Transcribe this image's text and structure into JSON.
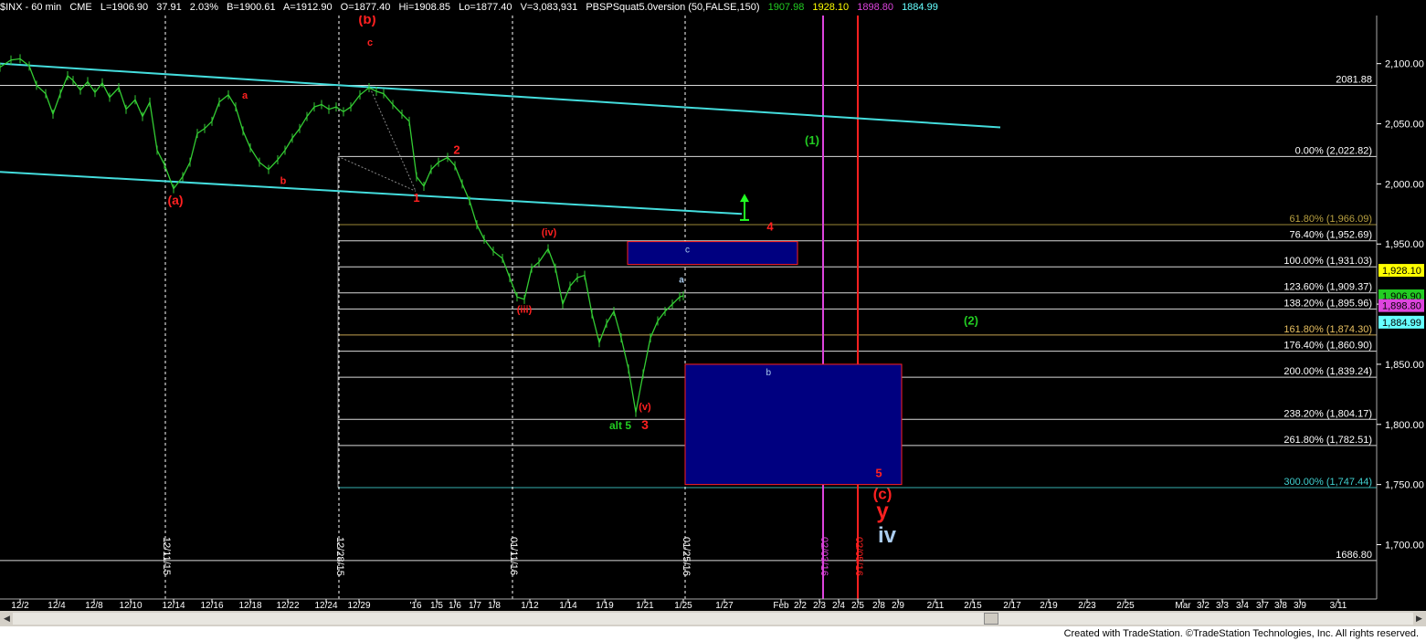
{
  "header": {
    "symbol": "$INX - 60 min",
    "exchange": "CME",
    "last": "L=1906.90",
    "change": "37.91",
    "change_pct": "2.03%",
    "bid": "B=1900.61",
    "ask": "A=1912.90",
    "open": "O=1877.40",
    "high": "Hi=1908.85",
    "low": "Lo=1877.40",
    "volume": "V=3,083,931",
    "indicator": "PBSPSquat5.0version (50,FALSE,150)",
    "ind_val1": "1907.98",
    "ind_val2": "1928.10",
    "ind_val3": "1898.80",
    "ind_val4": "1884.99"
  },
  "footer": {
    "credit": "Created with TradeStation. ©TradeStation Technologies, Inc. All rights reserved."
  },
  "colors": {
    "background": "#000000",
    "price": "#33cc33",
    "channel": "#44dddd",
    "red": "#ff2020",
    "green": "#22cc22",
    "box": "#000080",
    "magenta": "#dd44dd"
  },
  "chart_data": {
    "type": "line",
    "ylim": [
      1670,
      2140
    ],
    "y_ticks": [
      "2,100.00",
      "2,050.00",
      "2,000.00",
      "1,950.00",
      "1,900.00",
      "1,850.00",
      "1,800.00",
      "1,750.00",
      "1,700.00"
    ],
    "y_tick_values": [
      2100,
      2050,
      2000,
      1950,
      1900,
      1850,
      1800,
      1750,
      1700
    ],
    "x_ticks": [
      "12/2",
      "12/4",
      "12/8",
      "12/10",
      "12/14",
      "12/16",
      "12/18",
      "12/22",
      "12/24",
      "12/29",
      "'16",
      "1/5",
      "1/6",
      "1/7",
      "1/8",
      "1/12",
      "1/14",
      "1/19",
      "1/21",
      "1/25",
      "1/27",
      "Feb",
      "2/2",
      "2/3",
      "2/4",
      "2/5",
      "2/8",
      "2/9",
      "2/11",
      "2/15",
      "2/17",
      "2/19",
      "2/23",
      "2/25",
      "Mar",
      "3/2",
      "3/3",
      "3/4",
      "3/7",
      "3/8",
      "3/9",
      "3/11"
    ],
    "x_tick_positions": [
      22,
      62,
      103,
      143,
      190,
      232,
      274,
      315,
      357,
      393,
      455,
      478,
      498,
      520,
      541,
      580,
      622,
      662,
      706,
      748,
      793,
      855,
      876,
      897,
      918,
      939,
      962,
      983,
      1024,
      1065,
      1108,
      1148,
      1190,
      1232,
      1295,
      1317,
      1338,
      1360,
      1382,
      1402,
      1423,
      1465
    ],
    "price": [
      [
        0,
        2097
      ],
      [
        12,
        2103
      ],
      [
        22,
        2104
      ],
      [
        32,
        2098
      ],
      [
        40,
        2082
      ],
      [
        50,
        2075
      ],
      [
        58,
        2058
      ],
      [
        66,
        2075
      ],
      [
        74,
        2090
      ],
      [
        80,
        2086
      ],
      [
        88,
        2078
      ],
      [
        96,
        2085
      ],
      [
        104,
        2076
      ],
      [
        112,
        2084
      ],
      [
        120,
        2072
      ],
      [
        130,
        2080
      ],
      [
        138,
        2062
      ],
      [
        148,
        2070
      ],
      [
        156,
        2056
      ],
      [
        164,
        2068
      ],
      [
        172,
        2028
      ],
      [
        180,
        2016
      ],
      [
        190,
        1996
      ],
      [
        200,
        2006
      ],
      [
        208,
        2018
      ],
      [
        216,
        2042
      ],
      [
        224,
        2046
      ],
      [
        232,
        2052
      ],
      [
        240,
        2068
      ],
      [
        250,
        2074
      ],
      [
        258,
        2064
      ],
      [
        266,
        2044
      ],
      [
        274,
        2030
      ],
      [
        284,
        2018
      ],
      [
        294,
        2012
      ],
      [
        304,
        2020
      ],
      [
        312,
        2028
      ],
      [
        320,
        2038
      ],
      [
        328,
        2046
      ],
      [
        336,
        2056
      ],
      [
        344,
        2064
      ],
      [
        352,
        2066
      ],
      [
        360,
        2062
      ],
      [
        368,
        2064
      ],
      [
        376,
        2060
      ],
      [
        384,
        2064
      ],
      [
        394,
        2074
      ],
      [
        404,
        2080
      ],
      [
        412,
        2077
      ],
      [
        420,
        2075
      ],
      [
        430,
        2066
      ],
      [
        440,
        2058
      ],
      [
        448,
        2052
      ],
      [
        456,
        2006
      ],
      [
        464,
        1998
      ],
      [
        472,
        2012
      ],
      [
        480,
        2018
      ],
      [
        490,
        2022
      ],
      [
        498,
        2015
      ],
      [
        506,
        2000
      ],
      [
        514,
        1986
      ],
      [
        522,
        1966
      ],
      [
        530,
        1954
      ],
      [
        540,
        1944
      ],
      [
        550,
        1938
      ],
      [
        558,
        1922
      ],
      [
        566,
        1906
      ],
      [
        574,
        1904
      ],
      [
        582,
        1930
      ],
      [
        590,
        1935
      ],
      [
        600,
        1946
      ],
      [
        608,
        1930
      ],
      [
        616,
        1900
      ],
      [
        624,
        1915
      ],
      [
        632,
        1922
      ],
      [
        640,
        1924
      ],
      [
        648,
        1892
      ],
      [
        656,
        1868
      ],
      [
        664,
        1884
      ],
      [
        672,
        1894
      ],
      [
        680,
        1872
      ],
      [
        688,
        1846
      ],
      [
        696,
        1810
      ],
      [
        704,
        1842
      ],
      [
        712,
        1872
      ],
      [
        720,
        1886
      ],
      [
        728,
        1894
      ],
      [
        736,
        1900
      ],
      [
        744,
        1906
      ],
      [
        748,
        1907
      ]
    ],
    "channel_lines": [
      {
        "from": [
          0,
          2100
        ],
        "to": [
          1095,
          2047
        ]
      },
      {
        "from": [
          0,
          2010
        ],
        "to": [
          812,
          1975
        ]
      }
    ],
    "fib_levels": [
      {
        "label": "2081.88",
        "value": 2081.88,
        "color": "#ffffff"
      },
      {
        "label": "0.00% (2,022.82)",
        "value": 2022.82,
        "color": "#ffffff"
      },
      {
        "label": "61.80% (1,966.09)",
        "value": 1966.09,
        "color": "#b8a040"
      },
      {
        "label": "76.40% (1,952.69)",
        "value": 1952.69,
        "color": "#ffffff"
      },
      {
        "label": "100.00% (1,931.03)",
        "value": 1931.03,
        "color": "#ffffff"
      },
      {
        "label": "123.60% (1,909.37)",
        "value": 1909.37,
        "color": "#ffffff"
      },
      {
        "label": "138.20% (1,895.96)",
        "value": 1895.96,
        "color": "#ffffff"
      },
      {
        "label": "161.80% (1,874.30)",
        "value": 1874.3,
        "color": "#e8c060"
      },
      {
        "label": "176.40% (1,860.90)",
        "value": 1860.9,
        "color": "#ffffff"
      },
      {
        "label": "200.00% (1,839.24)",
        "value": 1839.24,
        "color": "#ffffff"
      },
      {
        "label": "238.20% (1,804.17)",
        "value": 1804.17,
        "color": "#ffffff"
      },
      {
        "label": "261.80% (1,782.51)",
        "value": 1782.51,
        "color": "#ffffff"
      },
      {
        "label": "300.00% (1,747.44)",
        "value": 1747.44,
        "color": "#40d0d0"
      },
      {
        "label": "1686.80",
        "value": 1686.8,
        "color": "#ffffff"
      }
    ],
    "price_tags": [
      {
        "label": "1,928.10",
        "value": 1928.1,
        "bg": "#ffff00",
        "fg": "#000000"
      },
      {
        "label": "1,906.90",
        "value": 1906.9,
        "bg": "#22cc22",
        "fg": "#000000"
      },
      {
        "label": "1,898.80",
        "value": 1898.8,
        "bg": "#dd44dd",
        "fg": "#000000"
      },
      {
        "label": "1,884.99",
        "value": 1884.99,
        "bg": "#66ffff",
        "fg": "#000000"
      }
    ],
    "target_boxes": [
      {
        "label": "c",
        "x": [
          687,
          873
        ],
        "y": [
          1933,
          1952
        ]
      },
      {
        "label": "b",
        "x": [
          750,
          987
        ],
        "y": [
          1750,
          1850
        ]
      }
    ],
    "date_lines": [
      {
        "label": "12/11/15",
        "x": 181,
        "color": "#ffffff",
        "dashed": true
      },
      {
        "label": "12/28/15",
        "x": 371,
        "color": "#ffffff",
        "dashed": true
      },
      {
        "label": "01/11/16",
        "x": 561,
        "color": "#ffffff",
        "dashed": true
      },
      {
        "label": "01/25/16",
        "x": 750,
        "color": "#ffffff",
        "dashed": true
      },
      {
        "label": "02/03/16",
        "x": 901,
        "color": "#dd44dd",
        "dashed": false
      },
      {
        "label": "02/05/16",
        "x": 939,
        "color": "#ff2020",
        "dashed": false
      }
    ],
    "wave_labels": [
      {
        "text": "(b)",
        "x": 402,
        "y": 2133,
        "color": "#ff2020",
        "size": 15
      },
      {
        "text": "c",
        "x": 405,
        "y": 2115,
        "color": "#ff2020",
        "size": 11
      },
      {
        "text": "a",
        "x": 268,
        "y": 2071,
        "color": "#ff2020",
        "size": 11
      },
      {
        "text": "b",
        "x": 310,
        "y": 2000,
        "color": "#ff2020",
        "size": 11
      },
      {
        "text": "(a)",
        "x": 192,
        "y": 1983,
        "color": "#ff2020",
        "size": 14
      },
      {
        "text": "1",
        "x": 456,
        "y": 1985,
        "color": "#ff2020",
        "size": 13
      },
      {
        "text": "2",
        "x": 500,
        "y": 2025,
        "color": "#ff2020",
        "size": 13
      },
      {
        "text": "(iv)",
        "x": 601,
        "y": 1957,
        "color": "#ff2020",
        "size": 11
      },
      {
        "text": "(iii)",
        "x": 574,
        "y": 1893,
        "color": "#ff2020",
        "size": 11
      },
      {
        "text": "(v)",
        "x": 706,
        "y": 1812,
        "color": "#ff2020",
        "size": 11
      },
      {
        "text": "3",
        "x": 706,
        "y": 1796,
        "color": "#ff2020",
        "size": 14
      },
      {
        "text": "alt 5",
        "x": 679,
        "y": 1796,
        "color": "#22cc22",
        "size": 12
      },
      {
        "text": "a",
        "x": 746,
        "y": 1918,
        "color": "#aaccee",
        "size": 10
      },
      {
        "text": "4",
        "x": 843,
        "y": 1961,
        "color": "#ff2020",
        "size": 13
      },
      {
        "text": "(1)",
        "x": 889,
        "y": 2033,
        "color": "#22cc22",
        "size": 13
      },
      {
        "text": "(2)",
        "x": 1063,
        "y": 1883,
        "color": "#22cc22",
        "size": 13
      },
      {
        "text": "5",
        "x": 962,
        "y": 1756,
        "color": "#ff2020",
        "size": 13
      },
      {
        "text": "(c)",
        "x": 966,
        "y": 1738,
        "color": "#ff2020",
        "size": 17
      },
      {
        "text": "y",
        "x": 966,
        "y": 1722,
        "color": "#ff2020",
        "size": 24
      },
      {
        "text": "iv",
        "x": 971,
        "y": 1702,
        "color": "#aaccee",
        "size": 24
      }
    ],
    "arrow": {
      "x": 815,
      "y_from": 1970,
      "y_to": 1988
    }
  }
}
